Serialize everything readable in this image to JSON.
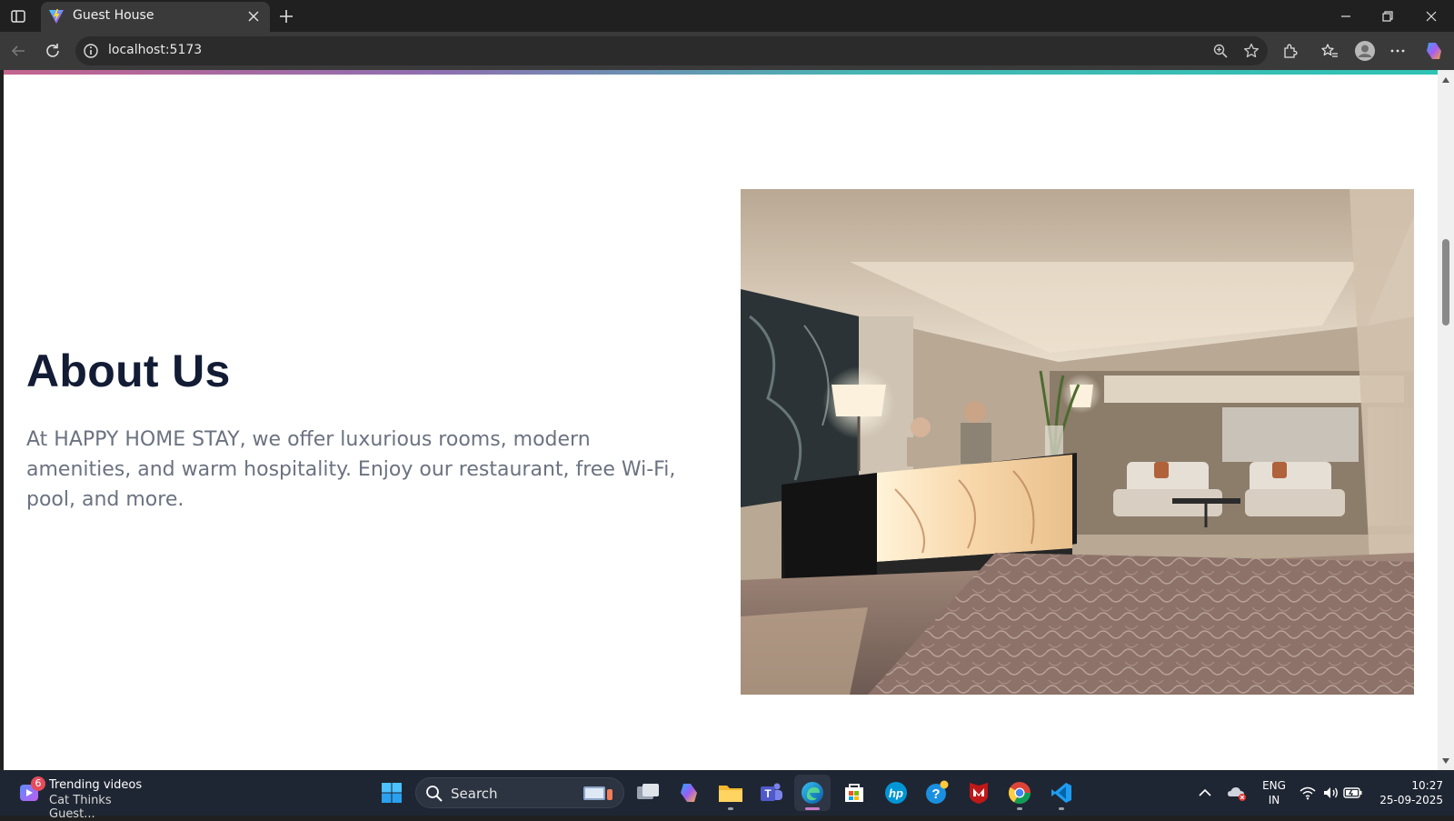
{
  "browser": {
    "tab": {
      "title": "Guest House"
    },
    "address_bar": {
      "url": "localhost:5173"
    }
  },
  "page": {
    "about": {
      "heading": "About Us",
      "body": "At HAPPY HOME STAY, we offer luxurious rooms, modern amenities, and warm hospitality. Enjoy our restaurant, free Wi-Fi, pool, and more."
    },
    "image": {
      "subject": "hotel-lobby-reception"
    }
  },
  "taskbar": {
    "widget": {
      "badge": "6",
      "line1": "Trending videos",
      "line2": "Cat Thinks Guest..."
    },
    "search": {
      "label": "Search"
    },
    "apps": [
      "start",
      "task-view",
      "copilot",
      "file-explorer",
      "teams",
      "edge",
      "store",
      "hp",
      "help",
      "mcafee",
      "chrome",
      "vscode"
    ],
    "active_app": "edge",
    "tray": {
      "lang_top": "ENG",
      "lang_bottom": "IN",
      "time": "10:27",
      "date": "25-09-2025"
    }
  },
  "colors": {
    "heading": "#131c35",
    "body_text": "#6b7280",
    "accent_gradient_start": "#c4638f",
    "accent_gradient_end": "#2ec3b5"
  }
}
